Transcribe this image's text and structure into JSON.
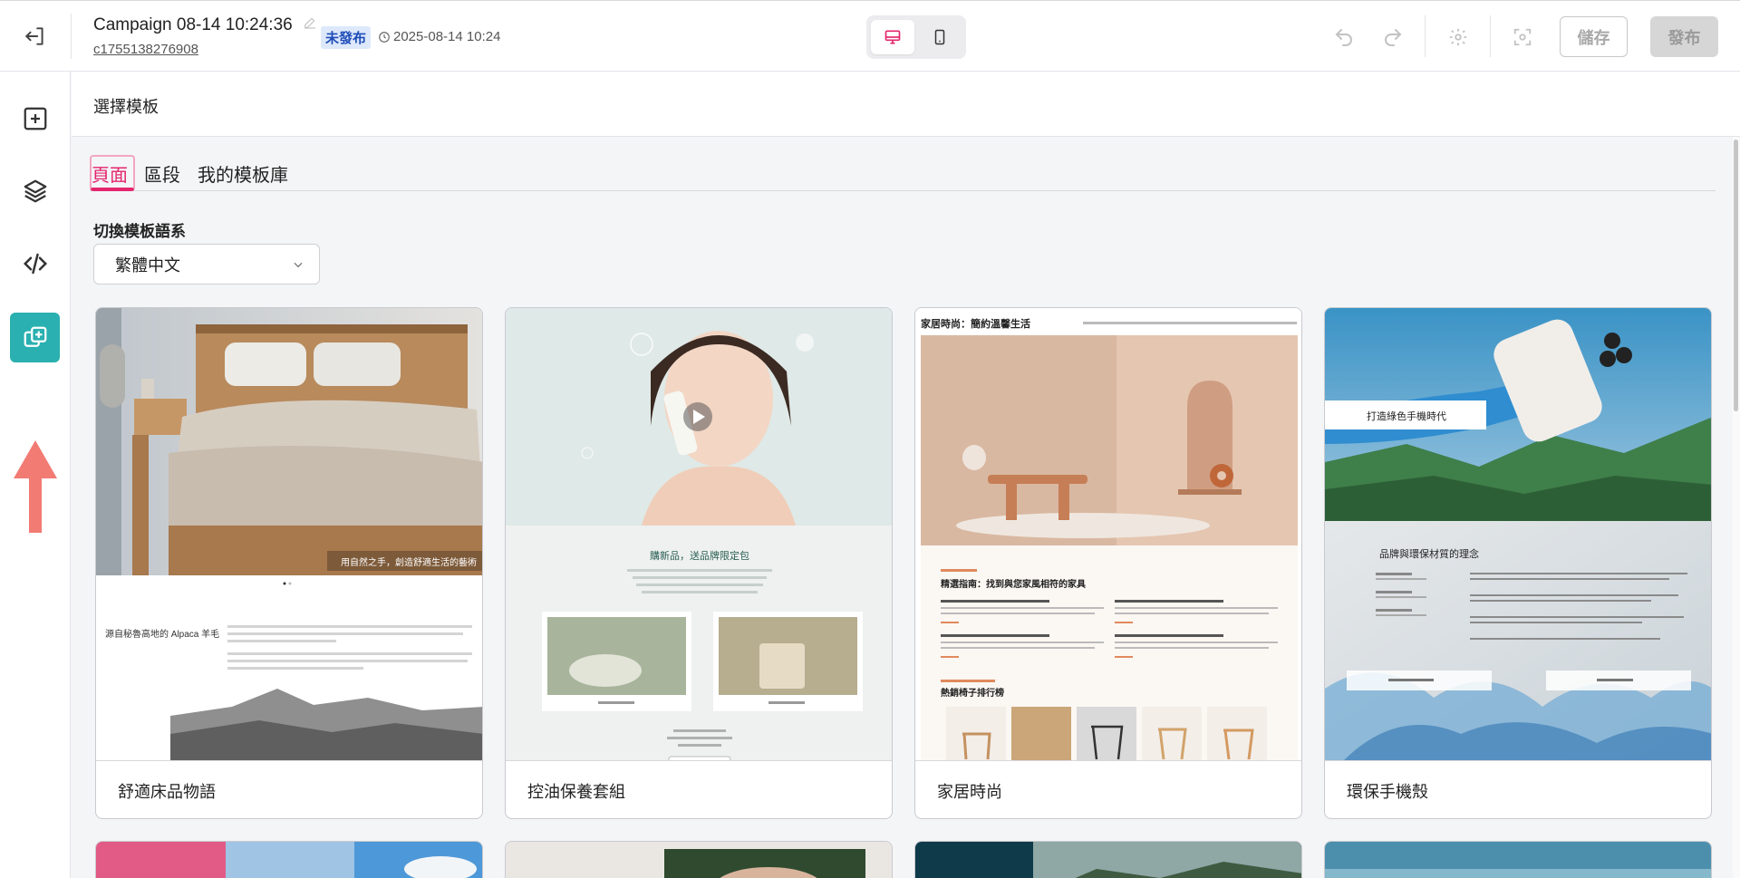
{
  "header": {
    "campaign_title": "Campaign 08-14 10:24:36",
    "campaign_id": "c1755138276908",
    "status_badge": "未發布",
    "timestamp": "2025-08-14 10:24",
    "save_label": "儲存",
    "publish_label": "發布",
    "active_device": "desktop"
  },
  "sidebar": {
    "items": [
      {
        "icon": "add-block-icon"
      },
      {
        "icon": "layers-icon"
      },
      {
        "icon": "code-icon"
      },
      {
        "icon": "templates-icon",
        "active": true
      }
    ]
  },
  "panel": {
    "title": "選擇模板",
    "tabs": [
      "頁面",
      "區段",
      "我的模板庫"
    ],
    "active_tab": 0,
    "language_label": "切換模板語系",
    "language_value": "繁體中文"
  },
  "templates": [
    {
      "name": "舒適床品物語",
      "hero_caption": "用自然之手，創造舒適生活的藝術",
      "subheading": "源自秘魯高地的 Alpaca 羊毛"
    },
    {
      "name": "控油保養套組",
      "heading": "購新品，送品牌限定包"
    },
    {
      "name": "家居時尚",
      "heading": "家居時尚：簡約溫馨生活",
      "guide_heading": "精選指南：找到與您家風相符的家具",
      "ranking_heading": "熱銷椅子排行榜"
    },
    {
      "name": "環保手機殼",
      "hero_label": "打造綠色手機時代",
      "heading": "品牌與環保材質的理念"
    }
  ],
  "colors": {
    "accent": "#e3266e",
    "rail_active": "#2ab0b0",
    "badge_bg": "#dde9fb",
    "badge_text": "#1f4db8",
    "arrow": "#f27b74"
  }
}
